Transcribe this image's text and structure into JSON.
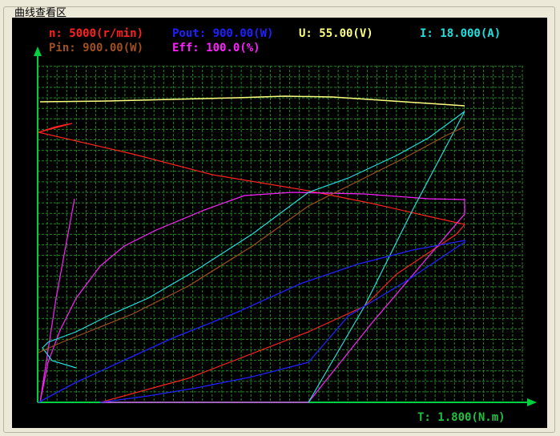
{
  "panel": {
    "title": "曲线查看区"
  },
  "legend": [
    {
      "text": "n: 5000(r/min)",
      "color": "#ff2020"
    },
    {
      "text": "Pout: 900.00(W)",
      "color": "#2020ff"
    },
    {
      "text": "U: 55.00(V)",
      "color": "#ffff80"
    },
    {
      "text": "I: 18.000(A)",
      "color": "#20e0e0"
    },
    {
      "text": "Pin: 900.00(W)",
      "color": "#a05020"
    },
    {
      "text": "Eff: 100.0(%)",
      "color": "#ff20ff"
    }
  ],
  "x_axis": {
    "label": "T: 1.800(N.m)",
    "color": "#20c040"
  },
  "colors": {
    "background": "#000000",
    "grid": "#1f8a1f",
    "axis": "#00d040"
  }
}
